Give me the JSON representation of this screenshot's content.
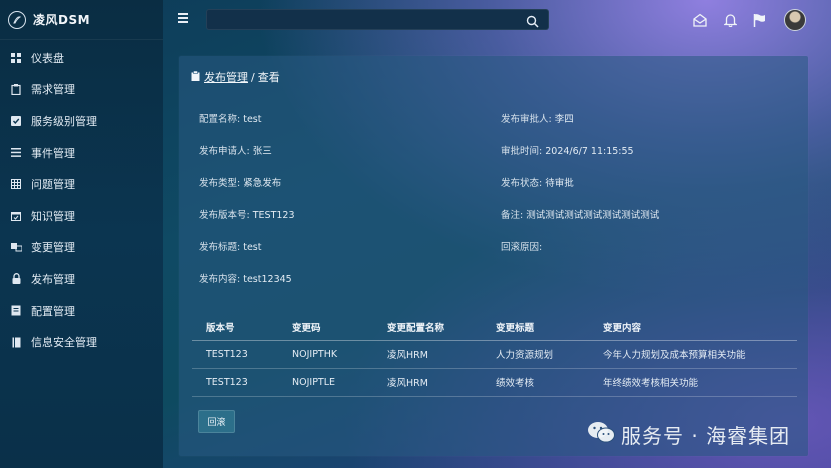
{
  "brand": {
    "name": "凌风DSM"
  },
  "sidebar": {
    "items": [
      {
        "label": "仪表盘",
        "icon": "dashboard-icon"
      },
      {
        "label": "需求管理",
        "icon": "clipboard-icon"
      },
      {
        "label": "服务级别管理",
        "icon": "check-square-icon"
      },
      {
        "label": "事件管理",
        "icon": "list-icon"
      },
      {
        "label": "问题管理",
        "icon": "grid-icon"
      },
      {
        "label": "知识管理",
        "icon": "calendar-check-icon"
      },
      {
        "label": "变更管理",
        "icon": "swap-icon"
      },
      {
        "label": "发布管理",
        "icon": "lock-icon"
      },
      {
        "label": "配置管理",
        "icon": "config-doc-icon"
      },
      {
        "label": "信息安全管理",
        "icon": "book-icon"
      }
    ]
  },
  "topbar": {
    "search_value": ""
  },
  "breadcrumb": {
    "parent": "发布管理",
    "separator": "/",
    "current": "查看"
  },
  "details": {
    "left": [
      {
        "label": "配置名称:",
        "value": "test"
      },
      {
        "label": "发布申请人:",
        "value": "张三"
      },
      {
        "label": "发布类型:",
        "value": "紧急发布"
      },
      {
        "label": "发布版本号:",
        "value": "TEST123"
      },
      {
        "label": "发布标题:",
        "value": "test"
      },
      {
        "label": "发布内容:",
        "value": "test12345"
      }
    ],
    "right": [
      {
        "label": "发布审批人:",
        "value": "李四"
      },
      {
        "label": "审批时间:",
        "value": "2024/6/7 11:15:55"
      },
      {
        "label": "发布状态:",
        "value": "待审批"
      },
      {
        "label": "备注:",
        "value": "测试测试测试测试测试测试测试"
      },
      {
        "label": "回滚原因:",
        "value": ""
      }
    ]
  },
  "table": {
    "headers": [
      "版本号",
      "变更码",
      "变更配置名称",
      "变更标题",
      "变更内容"
    ],
    "rows": [
      [
        "TEST123",
        "NOJIPTHK",
        "凌风HRM",
        "人力资源规划",
        "今年人力规划及成本预算相关功能"
      ],
      [
        "TEST123",
        "NOJIPTLE",
        "凌风HRM",
        "绩效考核",
        "年终绩效考核相关功能"
      ]
    ]
  },
  "actions": {
    "rollback_label": "回滚"
  },
  "watermark": {
    "text": "服务号 · 海睿集团"
  },
  "colors": {
    "sidebar_bg": "#0b3550",
    "card_bg": "#285a82",
    "button_bg": "#2c6f8a"
  }
}
